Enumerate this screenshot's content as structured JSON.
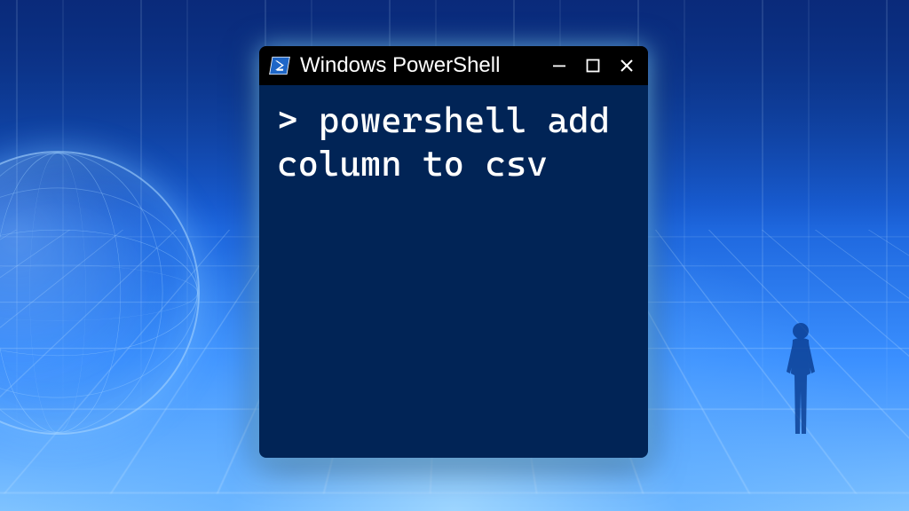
{
  "background": {
    "theme": "digital-blue-grid",
    "accent_color": "#2a7bff"
  },
  "window": {
    "title": "Windows PowerShell",
    "icon": "powershell-icon",
    "terminal_bg": "#012456",
    "controls": {
      "minimize": "minimize",
      "maximize": "maximize",
      "close": "close"
    },
    "content": {
      "prompt": ">",
      "command_lines": "powershell add column to csv"
    }
  }
}
